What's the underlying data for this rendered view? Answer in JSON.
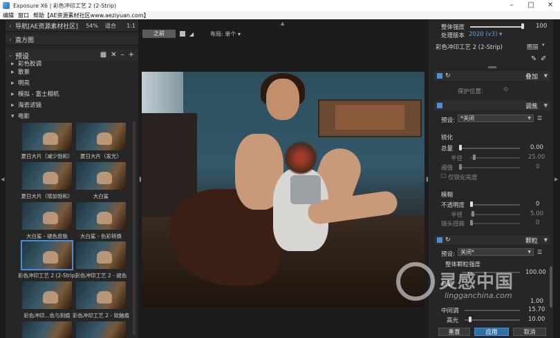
{
  "window": {
    "title": "Exposure X6 | 彩色冲印工艺 2 (2-Strip)",
    "controls": [
      "–",
      "□",
      "✕"
    ]
  },
  "menu": [
    "编辑",
    "窗口",
    "帮助【AE资源素材社区www.aeziyuan.com】"
  ],
  "left": {
    "nav_label": "导航[AE资源素材社区]",
    "nav_zoom": "54%",
    "nav_fit": "适合",
    "nav_ratio": "1:1",
    "histogram_label": "直方图",
    "presets_label": "预设",
    "presets_add": "+",
    "presets_remove": "–",
    "categories": [
      "彩色胶调",
      "散景",
      "明亮",
      "模拟 - 富士相机",
      "海瓷滤镜",
      "电影"
    ],
    "thumbnails": [
      {
        "label": "夏日大片（减少饱和）"
      },
      {
        "label": "夏日大片（发光）"
      },
      {
        "label": "夏日大片（增加饱和）"
      },
      {
        "label": "大白鲨"
      },
      {
        "label": "大白鲨 - 褪色皮肤"
      },
      {
        "label": "大白鲨 - 色彩转换"
      },
      {
        "label": "彩色冲印工艺 2 (2-Strip)"
      },
      {
        "label": "彩色冲印工艺 2 - 褪色"
      },
      {
        "label": "彩色冲印...色与刻痕"
      },
      {
        "label": "彩色冲印工艺 2 - 软触痕"
      }
    ]
  },
  "center": {
    "before_label": "之前",
    "layout_label": "布局: 单个"
  },
  "right": {
    "overall_label": "整体强度",
    "overall_value": "100",
    "process_label": "处理版本",
    "process_value": "2020 (v3)",
    "preset_name": "彩色冲印工艺 2 (2-Strip)",
    "layers_label": "图层",
    "overlay_section": "叠加",
    "protect_label": "保护位置:",
    "focus_section": "调焦",
    "preset_prefix": "预设:",
    "focus_preset_value": "*关闭",
    "sharpen_label": "锐化",
    "amount_label": "总量",
    "amount_value": "0.00",
    "radius_label": "半径",
    "radius_value": "25.00",
    "threshold_label": "阈值",
    "threshold_value": "0",
    "luma_only_label": "仅锐化亮度",
    "blur_label": "模糊",
    "opacity_label": "不透明度",
    "opacity_value": "0",
    "blur_radius_label": "半径",
    "blur_radius_value": "5.00",
    "lens_distort_label": "镜头扭曲",
    "lens_distort_value": "0",
    "grain_section": "颗粒",
    "grain_preset_value": "关闭*",
    "grain_overall_label": "整体颗粒强度",
    "grain_overall_value": "100.00",
    "grain_amount_label": "总量",
    "grain_amount_value": "1.00",
    "midtones_label": "中间调",
    "midtones_value": "15.70",
    "highlights_label": "高光",
    "highlights_value": "10.00",
    "reset_label": "重置",
    "apply_label": "应用",
    "cancel_label": "取消"
  },
  "watermark": {
    "title": "灵感中国",
    "url": "lingganchina.com"
  },
  "colors": {
    "accent": "#4a90d9",
    "panel": "#262626",
    "background": "#1c1c1c"
  }
}
